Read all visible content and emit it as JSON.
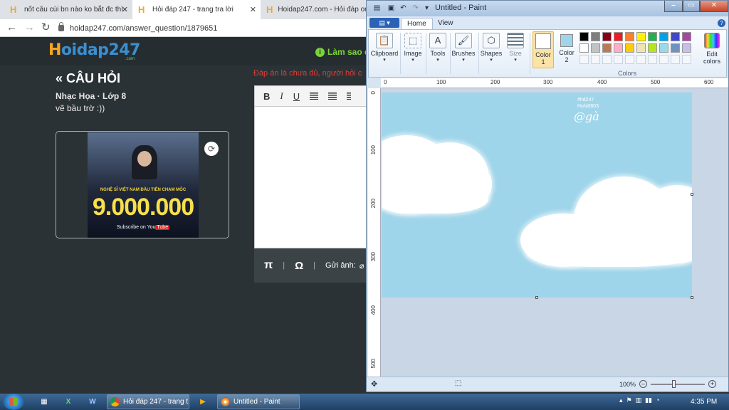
{
  "browser": {
    "tabs": [
      {
        "title": "nốt câu cùi bn nào ko bắt đc thì",
        "active": false
      },
      {
        "title": "Hỏi đáp 247 - trang tra lời",
        "active": true
      },
      {
        "title": "Hoidap247.com - Hỏi đáp onli",
        "active": false
      }
    ],
    "url": "hoidap247.com/answer_question/1879651"
  },
  "site": {
    "logo": "Hoidap247",
    "logo_sub": ".com",
    "howto": "Làm sao đ",
    "question_title": "« CÂU HỎI",
    "subject": "Nhạc Họa · Lớp 8",
    "question_text": "vẽ bầu trờ :))",
    "thumbnail": {
      "caption": "NGHỆ SĨ VIỆT NAM ĐẦU TIÊN CHẠM MỐC",
      "big_number": "9.000.000",
      "subscribe": "Subscribe on You",
      "tube": "Tube"
    },
    "answer_note": "Đáp án là chưa đủ, người hỏi c",
    "editor": {
      "bold": "B",
      "italic": "I",
      "underline": "U",
      "pi": "π",
      "separator": "|",
      "omega": "Ω",
      "upload_label": "Gửi ảnh:"
    }
  },
  "paint": {
    "title": "Untitled - Paint",
    "tabs": [
      "Home",
      "View"
    ],
    "groups": {
      "clipboard": "Clipboard",
      "image": "Image",
      "tools": "Tools",
      "brushes": "Brushes",
      "shapes": "Shapes",
      "size": "Size",
      "color1": "Color\n1",
      "color2": "Color\n2",
      "colors": "Colors",
      "edit_colors": "Edit\ncolors"
    },
    "palette": [
      "#000000",
      "#7f7f7f",
      "#880015",
      "#ed1c24",
      "#ff7f27",
      "#fff200",
      "#22b14c",
      "#00a2e8",
      "#3f48cc",
      "#a349a4",
      "#ffffff",
      "#c3c3c3",
      "#b97a57",
      "#ffaec9",
      "#ffc90e",
      "#efe4b0",
      "#b5e61d",
      "#99d9ea",
      "#7092be",
      "#c8bfe7"
    ],
    "color1": "#ffffff",
    "color2": "#9fd5ea",
    "canvas_color": "#9fd5ea",
    "ruler_top": [
      "0",
      "100",
      "200",
      "300",
      "400",
      "500",
      "600"
    ],
    "ruler_left": [
      "0",
      "100",
      "200",
      "300",
      "400",
      "500"
    ],
    "watermark_line1": "#hd247",
    "watermark_line2": "Huhi0803",
    "signature": "@gà",
    "zoom": "100%"
  },
  "taskbar": {
    "tasks": [
      "Hỏi đáp 247 - trang t...",
      "Untitled - Paint"
    ],
    "time": "4:35 PM"
  }
}
